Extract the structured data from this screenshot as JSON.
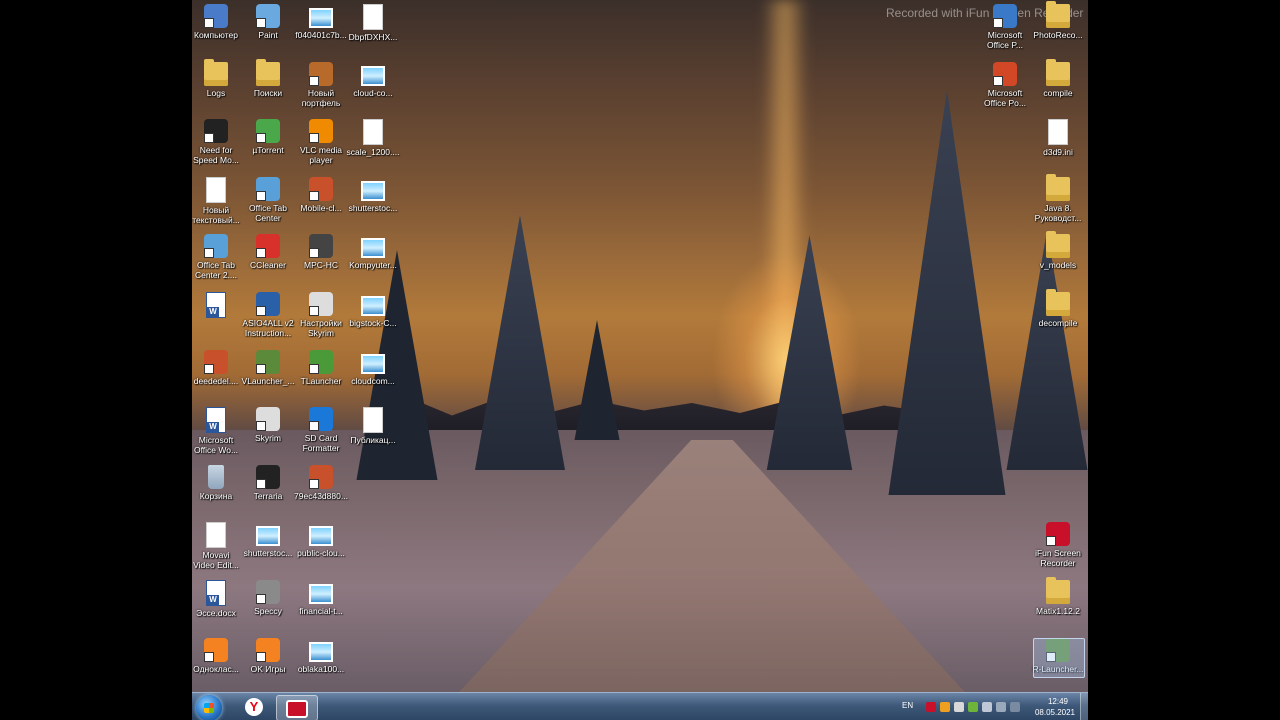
{
  "watermark": "Recorded with iFun Screen Recorder",
  "desktop": {
    "left_icons": [
      {
        "label": "Компьютер",
        "icon": "computer-icon",
        "kind": "app",
        "color": "#4a7bc8"
      },
      {
        "label": "Paint",
        "icon": "paint-icon",
        "kind": "app",
        "color": "#6aa8e0"
      },
      {
        "label": "f040401c7b...",
        "icon": "image-file-icon",
        "kind": "img"
      },
      {
        "label": "DbpfDXHX...",
        "icon": "document-icon",
        "kind": "doc"
      },
      {
        "label": "Logs",
        "icon": "folder-icon",
        "kind": "folder"
      },
      {
        "label": "Поиски",
        "icon": "folder-search-icon",
        "kind": "folder"
      },
      {
        "label": "Новый\nпортфель",
        "icon": "briefcase-icon",
        "kind": "app",
        "color": "#b86a2a"
      },
      {
        "label": "cloud-co...",
        "icon": "image-file-icon",
        "kind": "img"
      },
      {
        "label": "Need for\nSpeed Mo...",
        "icon": "game-icon",
        "kind": "app",
        "color": "#222222"
      },
      {
        "label": "µTorrent",
        "icon": "utorrent-icon",
        "kind": "app",
        "color": "#4aa84a"
      },
      {
        "label": "VLC media\nplayer",
        "icon": "vlc-icon",
        "kind": "app",
        "color": "#f08a00"
      },
      {
        "label": "scale_1200....",
        "icon": "document-icon",
        "kind": "doc"
      },
      {
        "label": "Новый\nтекстовый...",
        "icon": "text-file-icon",
        "kind": "doc"
      },
      {
        "label": "Office Tab\nCenter",
        "icon": "office-tab-icon",
        "kind": "app",
        "color": "#5aa0d8"
      },
      {
        "label": "Mobile-cl...",
        "icon": "image-file-icon",
        "kind": "app",
        "color": "#c8502a"
      },
      {
        "label": "shutterstoc...",
        "icon": "image-file-icon",
        "kind": "img"
      },
      {
        "label": "Office Tab\nCenter 2....",
        "icon": "office-tab-icon",
        "kind": "app",
        "color": "#5aa0d8"
      },
      {
        "label": "CCleaner",
        "icon": "ccleaner-icon",
        "kind": "app",
        "color": "#d8302a"
      },
      {
        "label": "MPC-HC",
        "icon": "mpc-icon",
        "kind": "app",
        "color": "#444444"
      },
      {
        "label": "Kompyuter...",
        "icon": "image-file-icon",
        "kind": "img"
      },
      {
        "label": "",
        "icon": "word-document-icon",
        "kind": "word"
      },
      {
        "label": "ASIO4ALL v2\nInstruction...",
        "icon": "asio-icon",
        "kind": "app",
        "color": "#2a60a8"
      },
      {
        "label": "Настройки\nSkyrim",
        "icon": "skyrim-icon",
        "kind": "app",
        "color": "#dddddd"
      },
      {
        "label": "bigstock-C...",
        "icon": "image-file-icon",
        "kind": "img"
      },
      {
        "label": "deededel....",
        "icon": "image-file-icon",
        "kind": "app",
        "color": "#c8502a"
      },
      {
        "label": "VLauncher_...",
        "icon": "minecraft-icon",
        "kind": "app",
        "color": "#5a8a3a"
      },
      {
        "label": "TLauncher",
        "icon": "minecraft-icon",
        "kind": "app",
        "color": "#4a9a3a"
      },
      {
        "label": "cloudcom...",
        "icon": "image-file-icon",
        "kind": "img"
      },
      {
        "label": "Microsoft\nOffice Wo...",
        "icon": "word-document-icon",
        "kind": "word"
      },
      {
        "label": "Skyrim",
        "icon": "skyrim-icon",
        "kind": "app",
        "color": "#dddddd"
      },
      {
        "label": "SD Card\nFormatter",
        "icon": "sd-card-icon",
        "kind": "app",
        "color": "#1a78d8"
      },
      {
        "label": "Публикац...",
        "icon": "publication-icon",
        "kind": "doc"
      },
      {
        "label": "Корзина",
        "icon": "recycle-bin-icon",
        "kind": "bin"
      },
      {
        "label": "Terraria",
        "icon": "terraria-icon",
        "kind": "app",
        "color": "#222222"
      },
      {
        "label": "79ec43d880...",
        "icon": "image-file-icon",
        "kind": "app",
        "color": "#c8502a"
      },
      {
        "label": "",
        "icon": "",
        "kind": "none"
      },
      {
        "label": "Movavi\nVideo Edit...",
        "icon": "document-icon",
        "kind": "doc"
      },
      {
        "label": "shutterstoc...",
        "icon": "image-file-icon",
        "kind": "img"
      },
      {
        "label": "public-clou...",
        "icon": "image-file-icon",
        "kind": "img"
      },
      {
        "label": "",
        "icon": "",
        "kind": "none"
      },
      {
        "label": "Эссе.docx",
        "icon": "word-document-icon",
        "kind": "word"
      },
      {
        "label": "Speccy",
        "icon": "speccy-icon",
        "kind": "app",
        "color": "#8a8a8a"
      },
      {
        "label": "financial-t...",
        "icon": "image-file-icon",
        "kind": "img"
      },
      {
        "label": "",
        "icon": "",
        "kind": "none"
      },
      {
        "label": "Одноклас...",
        "icon": "odnoklassniki-icon",
        "kind": "app",
        "color": "#f58220"
      },
      {
        "label": "OK Игры",
        "icon": "ok-games-icon",
        "kind": "app",
        "color": "#f58220"
      },
      {
        "label": "oblaka100...",
        "icon": "image-file-icon",
        "kind": "img"
      },
      {
        "label": "",
        "icon": "",
        "kind": "none"
      }
    ],
    "right_icons": [
      {
        "label": "Microsoft\nOffice P...",
        "icon": "office-picture-icon",
        "kind": "app",
        "color": "#3a78c8",
        "col": 0,
        "row": 0
      },
      {
        "label": "PhotoReco...",
        "icon": "folder-icon",
        "kind": "folder",
        "col": 1,
        "row": 0
      },
      {
        "label": "Microsoft\nOffice Po...",
        "icon": "powerpoint-icon",
        "kind": "app",
        "color": "#d24726",
        "col": 0,
        "row": 1
      },
      {
        "label": "compile",
        "icon": "folder-icon",
        "kind": "folder",
        "col": 1,
        "row": 1
      },
      {
        "label": "d3d9.ini",
        "icon": "ini-file-icon",
        "kind": "doc",
        "col": 1,
        "row": 2
      },
      {
        "label": "Java 8.\nРуководст...",
        "icon": "folder-icon",
        "kind": "folder",
        "col": 1,
        "row": 3
      },
      {
        "label": "v_models",
        "icon": "folder-icon",
        "kind": "folder",
        "col": 1,
        "row": 4
      },
      {
        "label": "decompile",
        "icon": "folder-icon",
        "kind": "folder",
        "col": 1,
        "row": 5
      },
      {
        "label": "iFun Screen\nRecorder",
        "icon": "ifun-recorder-icon",
        "kind": "app",
        "color": "#c9102a",
        "col": 1,
        "row": 9
      },
      {
        "label": "Matix1.12.2",
        "icon": "folder-icon",
        "kind": "folder",
        "col": 1,
        "row": 10
      },
      {
        "label": "R-Launcher...",
        "icon": "minecraft-icon",
        "kind": "app",
        "color": "#5a8a3a",
        "col": 1,
        "row": 11
      }
    ]
  },
  "taskbar": {
    "start_label": "Start",
    "pinned": [
      {
        "name": "yandex-browser",
        "glyph": "Y"
      },
      {
        "name": "ifun-screen-recorder",
        "glyph": ""
      }
    ],
    "tray": {
      "language": "EN",
      "time": "12:49",
      "date": "08.05.2021"
    }
  }
}
